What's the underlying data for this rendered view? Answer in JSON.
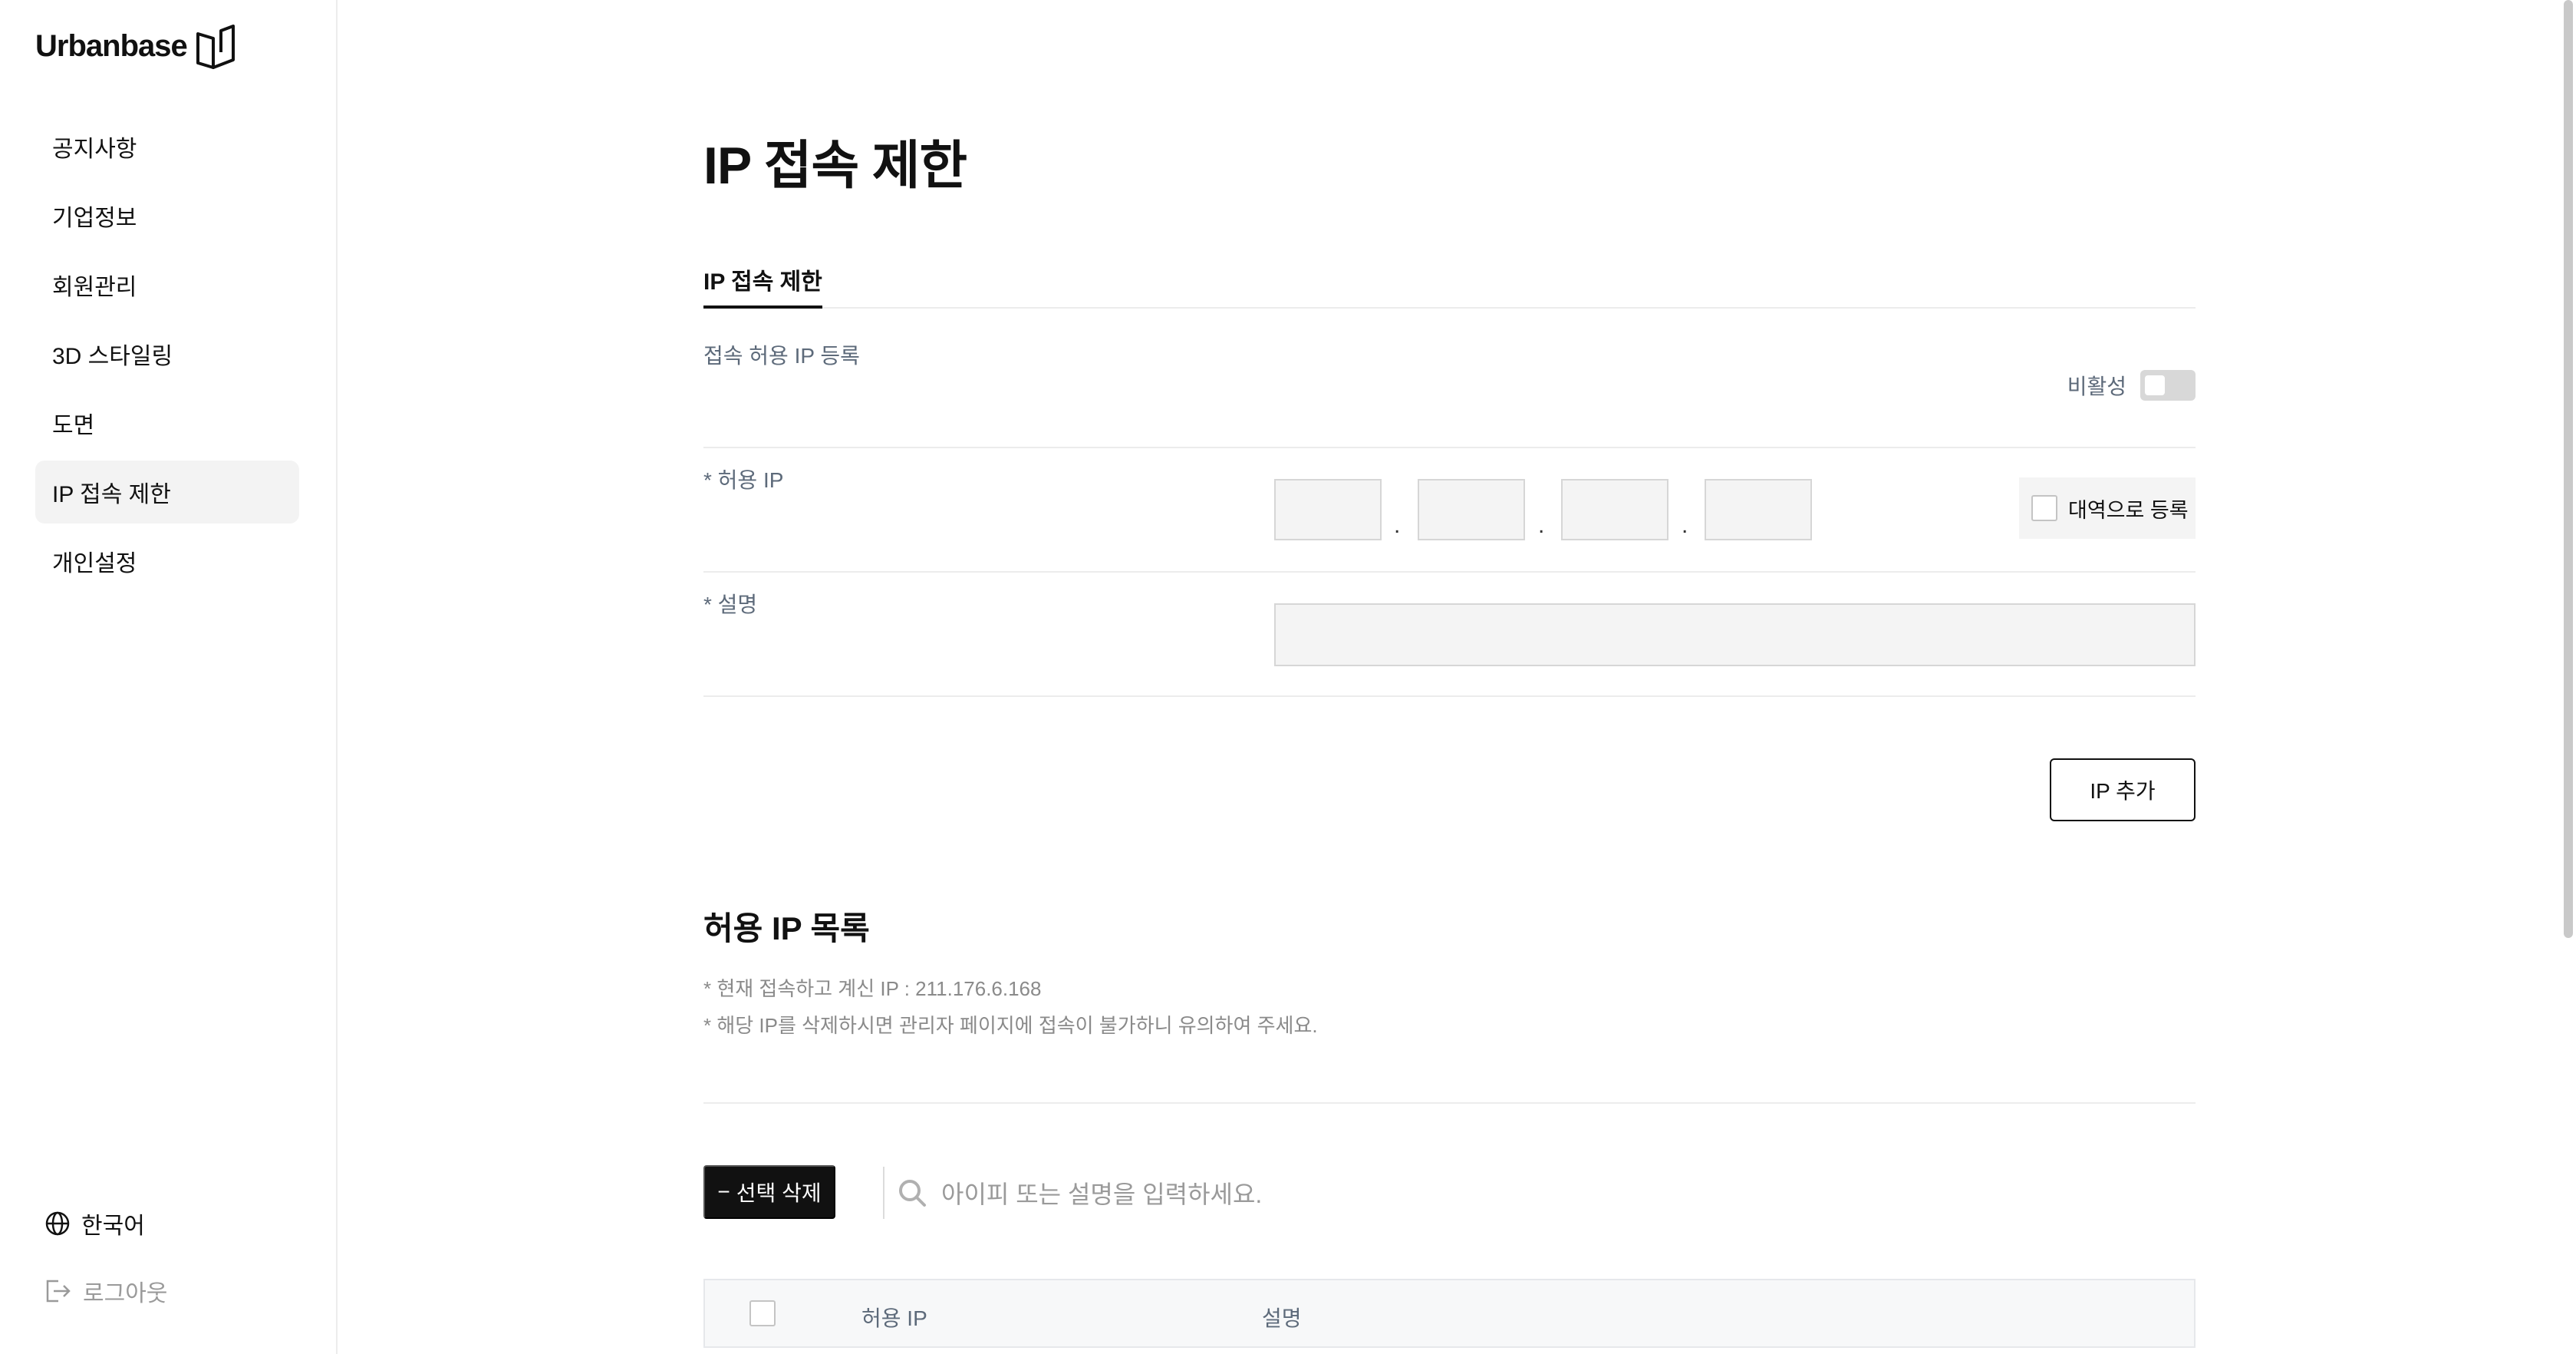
{
  "app": {
    "logo_text": "Urbanbase"
  },
  "sidebar": {
    "items": [
      {
        "label": "공지사항"
      },
      {
        "label": "기업정보"
      },
      {
        "label": "회원관리"
      },
      {
        "label": "3D 스타일링"
      },
      {
        "label": "도면"
      },
      {
        "label": "IP 접속 제한",
        "active": true
      },
      {
        "label": "개인설정"
      }
    ],
    "language": "한국어",
    "logout": "로그아웃"
  },
  "main": {
    "title": "IP 접속 제한",
    "tab": "IP 접속 제한",
    "section_label": "접속 허용 IP 등록",
    "toggle_label": "비활성",
    "toggle_on": false,
    "allowed_ip_label": "* 허용 IP",
    "ip_fields": [
      "",
      "",
      "",
      ""
    ],
    "ip_separator": ".",
    "range_label": "대역으로 등록",
    "description_label": "* 설명",
    "description_value": "",
    "add_button": "IP 추가"
  },
  "list": {
    "title": "허용 IP 목록",
    "note_current_ip": "* 현재 접속하고 계신 IP : 211.176.6.168",
    "note_warning": "* 해당 IP를 삭제하시면 관리자 페이지에 접속이 불가하니 유의하여 주세요.",
    "delete_button": "선택 삭제",
    "delete_icon": "−",
    "search_placeholder": "아이피 또는 설명을 입력하세요.",
    "columns": [
      "허용 IP",
      "설명"
    ]
  },
  "colors": {
    "accent": "#111111",
    "muted_label": "#5d6a7a",
    "input_bg": "#f4f4f4"
  }
}
